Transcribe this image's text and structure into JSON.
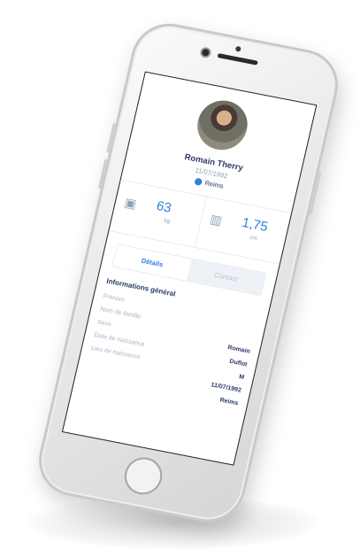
{
  "profile": {
    "name": "Romain Therry",
    "birthdate": "11/07/1992",
    "location": "Reims"
  },
  "stats": [
    {
      "icon": "scale-icon",
      "value": "63",
      "unit": "kg"
    },
    {
      "icon": "height-icon",
      "value": "1,75",
      "unit": "cm"
    }
  ],
  "tabs": {
    "details": "Détails",
    "contact": "Contact"
  },
  "info": {
    "title": "Informations général",
    "rows": [
      {
        "label": "Prénom",
        "value": ""
      },
      {
        "label": "Nom de famille",
        "value": ""
      },
      {
        "label": "Sexe",
        "value": "Romain"
      },
      {
        "label": "Date de naissance",
        "value": "Duflot"
      },
      {
        "label": "Lieu de naissance",
        "value": "M"
      },
      {
        "label": "",
        "value": "11/07/1992"
      },
      {
        "label": "",
        "value": "Reims"
      }
    ]
  },
  "colors": {
    "accent": "#2f7fe0",
    "text_dark": "#2b3a6a",
    "text_muted": "#8fa3b8"
  }
}
